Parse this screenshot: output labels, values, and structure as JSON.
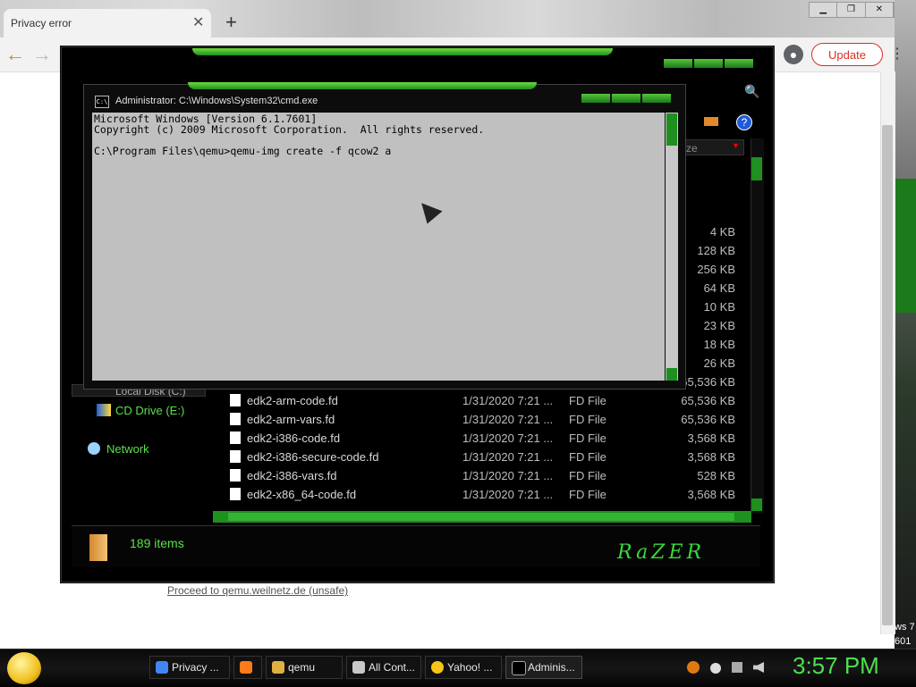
{
  "browser": {
    "tab_title": "Privacy error",
    "tab_close": "✕",
    "new_tab": "+",
    "window_buttons": [
      "▁",
      "❐",
      "✕"
    ],
    "back": "←",
    "forward": "→",
    "update_label": "Update",
    "menu": "⋮",
    "proceed_link": "Proceed to qemu.weilnetz.de (unsafe)"
  },
  "explorer": {
    "combo_value": "ze",
    "nav": {
      "local_disk": "Local Disk (C:)",
      "cd_drive": "CD Drive (E:)",
      "network": "Network"
    },
    "sizes_above": [
      "4 KB",
      "128 KB",
      "256 KB",
      "64 KB",
      "10 KB",
      "23 KB",
      "18 KB",
      "26 KB",
      "65,536 KB"
    ],
    "files": [
      {
        "name": "edk2-arm-code.fd",
        "date": "1/31/2020 7:21 ...",
        "type": "FD File",
        "size": "65,536 KB"
      },
      {
        "name": "edk2-arm-vars.fd",
        "date": "1/31/2020 7:21 ...",
        "type": "FD File",
        "size": "65,536 KB"
      },
      {
        "name": "edk2-i386-code.fd",
        "date": "1/31/2020 7:21 ...",
        "type": "FD File",
        "size": "3,568 KB"
      },
      {
        "name": "edk2-i386-secure-code.fd",
        "date": "1/31/2020 7:21 ...",
        "type": "FD File",
        "size": "3,568 KB"
      },
      {
        "name": "edk2-i386-vars.fd",
        "date": "1/31/2020 7:21 ...",
        "type": "FD File",
        "size": "528 KB"
      },
      {
        "name": "edk2-x86_64-code.fd",
        "date": "1/31/2020 7:21 ...",
        "type": "FD File",
        "size": "3,568 KB"
      }
    ],
    "status_count": "189 items",
    "logo_text": "RaZER"
  },
  "cmd": {
    "icon_text": "C:\\",
    "title": "Administrator: C:\\Windows\\System32\\cmd.exe",
    "lines": [
      "Microsoft Windows [Version 6.1.7601]",
      "Copyright (c) 2009 Microsoft Corporation.  All rights reserved.",
      "",
      "C:\\Program Files\\qemu>qemu-img create -f qcow2 a"
    ]
  },
  "taskbar": {
    "buttons": [
      {
        "label": "Privacy ...",
        "icon": "chrome-icon",
        "color": "#4285f4"
      },
      {
        "label": "",
        "icon": "firefox-icon",
        "color": "#ff7a18"
      },
      {
        "label": "qemu",
        "icon": "folder-icon",
        "color": "#e0b040"
      },
      {
        "label": "All Cont...",
        "icon": "contacts-icon",
        "color": "#c8c8c8"
      },
      {
        "label": "Yahoo! ...",
        "icon": "yahoo-smiley-icon",
        "color": "#f5c518"
      },
      {
        "label": "Adminis...",
        "icon": "cmd-icon",
        "color": "#000000"
      }
    ],
    "clock": "3:57 PM"
  },
  "desktop": {
    "text1": "ws 7",
    "text2": "601"
  }
}
